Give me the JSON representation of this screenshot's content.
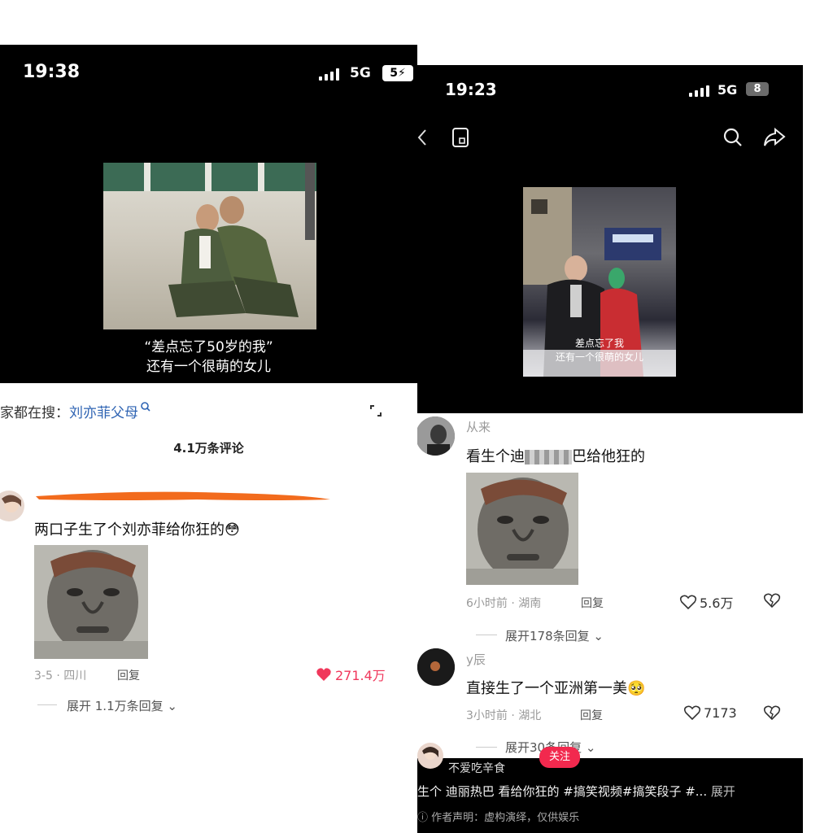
{
  "left": {
    "status": {
      "time": "19:38",
      "network": "5G",
      "battery": "5⚡"
    },
    "video": {
      "caption_line1": "“差点忘了50岁的我”",
      "caption_line2": "还有一个很萌的女儿"
    },
    "search": {
      "prefix": "家都在搜：",
      "term": "刘亦菲父母"
    },
    "comments_count": "4.1万条评论",
    "comment": {
      "text": "两口子生了个刘亦菲给你狂的",
      "emoji": "😳",
      "date_location": "3-5 · 四川",
      "reply_label": "回复",
      "likes": "271.4万",
      "expand_label": "展开 1.1万条回复"
    }
  },
  "right": {
    "status": {
      "time": "19:23",
      "network": "5G",
      "battery": "8"
    },
    "video": {
      "caption_line1": "差点忘了我",
      "caption_line2": "还有一个很萌的女儿"
    },
    "comment1": {
      "user": "从来",
      "text_a": "看生个迪",
      "text_b": "巴给他狂的",
      "time_location": "6小时前 · 湖南",
      "reply_label": "回复",
      "likes": "5.6万",
      "expand_label": "展开178条回复"
    },
    "comment2": {
      "user": "y辰",
      "text": "直接生了一个亚洲第一美",
      "emoji": "🥺",
      "time_location": "3小时前 · 湖北",
      "reply_label": "回复",
      "likes": "7173",
      "expand_label": "展开30条回复"
    },
    "bottom": {
      "author": "不爱吃辛食",
      "follow_label": "关注",
      "description": "生个 迪丽热巴  看给你狂的 #搞笑视频#搞笑段子 #...",
      "expand_label": "展开",
      "disclaimer": "作者声明：虚构演绎，仅供娱乐"
    }
  },
  "colors": {
    "like_red": "#f0375b",
    "follow_red": "#f2294e",
    "search_blue": "#2f64b3"
  },
  "icons": [
    "signal-icon",
    "battery-icon",
    "expand-icon",
    "heart-icon",
    "dislike-icon",
    "back-icon",
    "bookmark-icon",
    "search-icon",
    "share-icon"
  ]
}
